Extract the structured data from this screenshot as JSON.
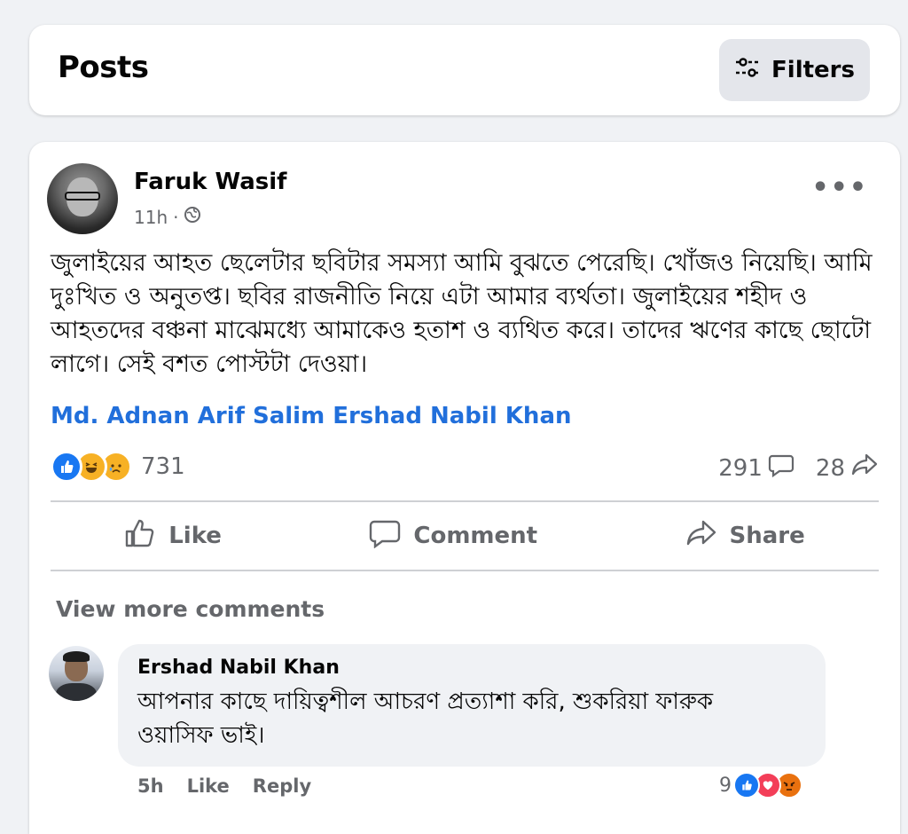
{
  "header": {
    "title": "Posts",
    "filters_label": "Filters"
  },
  "post": {
    "author": "Faruk Wasif",
    "time": "11h",
    "audience_icon": "globe-icon",
    "text": "জুলাইয়ের আহত ছেলেটার ছবিটার সমস্যা আমি বুঝতে পেরেছি। খোঁজও নিয়েছি। আমি দুঃখিত ও অনুতপ্ত। ছবির রাজনীতি নিয়ে এটা আমার ব্যর্থতা। জুলাইয়ের শহীদ ও আহতদের বঞ্চনা মাঝেমধ্যে আমাকেও হতাশ ও ব্যথিত করে। তাদের ঋণের কাছে ছোটো লাগে। সেই বশত পোস্টটা দেওয়া।",
    "tagged": "Md. Adnan Arif Salim Ershad Nabil Khan",
    "reactions": {
      "types": [
        "like",
        "haha",
        "sad"
      ],
      "count": "731"
    },
    "comments_count": "291",
    "shares_count": "28"
  },
  "actions": {
    "like": "Like",
    "comment": "Comment",
    "share": "Share"
  },
  "comments_section": {
    "view_more": "View more comments",
    "comment": {
      "author": "Ershad Nabil Khan",
      "text": "আপনার কাছে দায়িত্বশীল আচরণ প্রত্যাশা করি, শুকরিয়া ফারুক ওয়াসিফ ভাই।",
      "time": "5h",
      "like_label": "Like",
      "reply_label": "Reply",
      "reactions": {
        "types": [
          "like",
          "love",
          "angry"
        ],
        "count": "9"
      }
    }
  },
  "colors": {
    "link_blue": "#216fdb",
    "like_blue": "#1877f2",
    "secondary_text": "#65676b",
    "background": "#f0f2f5"
  }
}
